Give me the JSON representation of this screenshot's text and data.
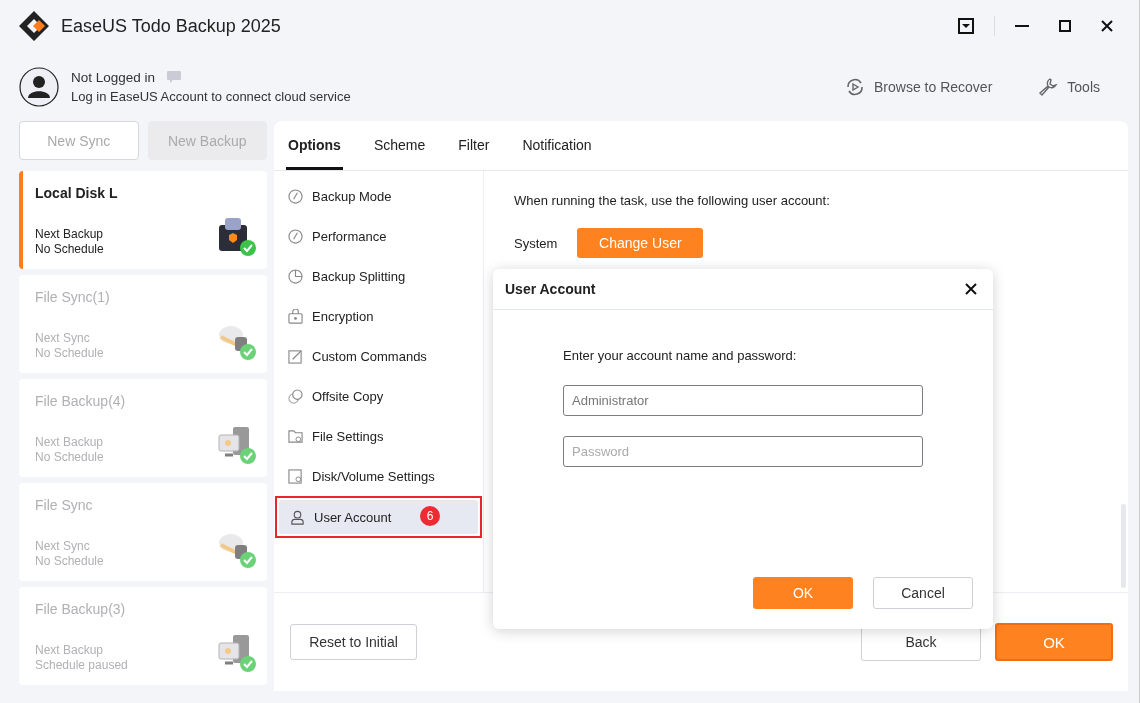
{
  "window": {
    "title": "EaseUS Todo Backup 2025"
  },
  "account": {
    "status": "Not Logged in",
    "message": "Log in EaseUS Account to connect cloud service"
  },
  "actions": [
    {
      "label": "Browse to Recover",
      "kind": "recover"
    },
    {
      "label": "Tools",
      "kind": "tools"
    }
  ],
  "sidebar_buttons": [
    {
      "label": "New Sync",
      "kind": "outline"
    },
    {
      "label": "New Backup",
      "kind": "filled"
    }
  ],
  "tasks": [
    {
      "name": "Local Disk L",
      "line_1": "Next Backup",
      "line_2": "No Schedule",
      "kind": "disk",
      "selected": true
    },
    {
      "name": "File Sync(1)",
      "line_1": "Next Sync",
      "line_2": "No Schedule",
      "kind": "sync",
      "selected": false
    },
    {
      "name": "File Backup(4)",
      "line_1": "Next Backup",
      "line_2": "No Schedule",
      "kind": "backup",
      "selected": false
    },
    {
      "name": "File Sync",
      "line_1": "Next Sync",
      "line_2": "No Schedule",
      "kind": "sync",
      "selected": false
    },
    {
      "name": "File Backup(3)",
      "line_1": "Next Backup",
      "line_2": "Schedule paused",
      "kind": "backup",
      "selected": false
    }
  ],
  "tabs": [
    {
      "label": "Options",
      "selected": true
    },
    {
      "label": "Scheme",
      "selected": false
    },
    {
      "label": "Filter",
      "selected": false
    },
    {
      "label": "Notification",
      "selected": false
    }
  ],
  "options_menu": [
    {
      "label": "Backup Mode",
      "kind": "gauge",
      "selected": false
    },
    {
      "label": "Performance",
      "kind": "gauge",
      "selected": false
    },
    {
      "label": "Backup Splitting",
      "kind": "pie",
      "selected": false
    },
    {
      "label": "Encryption",
      "kind": "lock",
      "selected": false
    },
    {
      "label": "Custom Commands",
      "kind": "edit",
      "selected": false
    },
    {
      "label": "Offsite Copy",
      "kind": "copy",
      "selected": false
    },
    {
      "label": "File Settings",
      "kind": "folder",
      "selected": false
    },
    {
      "label": "Disk/Volume Settings",
      "kind": "disk",
      "selected": false
    },
    {
      "label": "User Account",
      "kind": "user",
      "selected": true,
      "annotation": "6"
    }
  ],
  "content": {
    "prompt": "When running the task, use the following user account:",
    "account_label": "System",
    "change_button": "Change User"
  },
  "footer": {
    "reset": "Reset to Initial",
    "back": "Back",
    "ok": "OK"
  },
  "dialog": {
    "title": "User Account",
    "prompt": "Enter your account name and password:",
    "fields": [
      {
        "value": "Administrator"
      },
      {
        "placeholder": "Password"
      }
    ],
    "ok": "OK",
    "cancel": "Cancel"
  }
}
